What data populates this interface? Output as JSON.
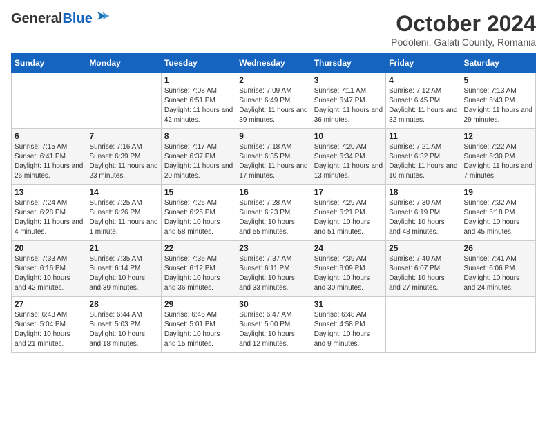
{
  "header": {
    "logo_line1": "General",
    "logo_line2": "Blue",
    "month_title": "October 2024",
    "location": "Podoleni, Galati County, Romania"
  },
  "weekdays": [
    "Sunday",
    "Monday",
    "Tuesday",
    "Wednesday",
    "Thursday",
    "Friday",
    "Saturday"
  ],
  "weeks": [
    [
      {
        "day": "",
        "sunrise": "",
        "sunset": "",
        "daylight": ""
      },
      {
        "day": "",
        "sunrise": "",
        "sunset": "",
        "daylight": ""
      },
      {
        "day": "1",
        "sunrise": "Sunrise: 7:08 AM",
        "sunset": "Sunset: 6:51 PM",
        "daylight": "Daylight: 11 hours and 42 minutes."
      },
      {
        "day": "2",
        "sunrise": "Sunrise: 7:09 AM",
        "sunset": "Sunset: 6:49 PM",
        "daylight": "Daylight: 11 hours and 39 minutes."
      },
      {
        "day": "3",
        "sunrise": "Sunrise: 7:11 AM",
        "sunset": "Sunset: 6:47 PM",
        "daylight": "Daylight: 11 hours and 36 minutes."
      },
      {
        "day": "4",
        "sunrise": "Sunrise: 7:12 AM",
        "sunset": "Sunset: 6:45 PM",
        "daylight": "Daylight: 11 hours and 32 minutes."
      },
      {
        "day": "5",
        "sunrise": "Sunrise: 7:13 AM",
        "sunset": "Sunset: 6:43 PM",
        "daylight": "Daylight: 11 hours and 29 minutes."
      }
    ],
    [
      {
        "day": "6",
        "sunrise": "Sunrise: 7:15 AM",
        "sunset": "Sunset: 6:41 PM",
        "daylight": "Daylight: 11 hours and 26 minutes."
      },
      {
        "day": "7",
        "sunrise": "Sunrise: 7:16 AM",
        "sunset": "Sunset: 6:39 PM",
        "daylight": "Daylight: 11 hours and 23 minutes."
      },
      {
        "day": "8",
        "sunrise": "Sunrise: 7:17 AM",
        "sunset": "Sunset: 6:37 PM",
        "daylight": "Daylight: 11 hours and 20 minutes."
      },
      {
        "day": "9",
        "sunrise": "Sunrise: 7:18 AM",
        "sunset": "Sunset: 6:35 PM",
        "daylight": "Daylight: 11 hours and 17 minutes."
      },
      {
        "day": "10",
        "sunrise": "Sunrise: 7:20 AM",
        "sunset": "Sunset: 6:34 PM",
        "daylight": "Daylight: 11 hours and 13 minutes."
      },
      {
        "day": "11",
        "sunrise": "Sunrise: 7:21 AM",
        "sunset": "Sunset: 6:32 PM",
        "daylight": "Daylight: 11 hours and 10 minutes."
      },
      {
        "day": "12",
        "sunrise": "Sunrise: 7:22 AM",
        "sunset": "Sunset: 6:30 PM",
        "daylight": "Daylight: 11 hours and 7 minutes."
      }
    ],
    [
      {
        "day": "13",
        "sunrise": "Sunrise: 7:24 AM",
        "sunset": "Sunset: 6:28 PM",
        "daylight": "Daylight: 11 hours and 4 minutes."
      },
      {
        "day": "14",
        "sunrise": "Sunrise: 7:25 AM",
        "sunset": "Sunset: 6:26 PM",
        "daylight": "Daylight: 11 hours and 1 minute."
      },
      {
        "day": "15",
        "sunrise": "Sunrise: 7:26 AM",
        "sunset": "Sunset: 6:25 PM",
        "daylight": "Daylight: 10 hours and 58 minutes."
      },
      {
        "day": "16",
        "sunrise": "Sunrise: 7:28 AM",
        "sunset": "Sunset: 6:23 PM",
        "daylight": "Daylight: 10 hours and 55 minutes."
      },
      {
        "day": "17",
        "sunrise": "Sunrise: 7:29 AM",
        "sunset": "Sunset: 6:21 PM",
        "daylight": "Daylight: 10 hours and 51 minutes."
      },
      {
        "day": "18",
        "sunrise": "Sunrise: 7:30 AM",
        "sunset": "Sunset: 6:19 PM",
        "daylight": "Daylight: 10 hours and 48 minutes."
      },
      {
        "day": "19",
        "sunrise": "Sunrise: 7:32 AM",
        "sunset": "Sunset: 6:18 PM",
        "daylight": "Daylight: 10 hours and 45 minutes."
      }
    ],
    [
      {
        "day": "20",
        "sunrise": "Sunrise: 7:33 AM",
        "sunset": "Sunset: 6:16 PM",
        "daylight": "Daylight: 10 hours and 42 minutes."
      },
      {
        "day": "21",
        "sunrise": "Sunrise: 7:35 AM",
        "sunset": "Sunset: 6:14 PM",
        "daylight": "Daylight: 10 hours and 39 minutes."
      },
      {
        "day": "22",
        "sunrise": "Sunrise: 7:36 AM",
        "sunset": "Sunset: 6:12 PM",
        "daylight": "Daylight: 10 hours and 36 minutes."
      },
      {
        "day": "23",
        "sunrise": "Sunrise: 7:37 AM",
        "sunset": "Sunset: 6:11 PM",
        "daylight": "Daylight: 10 hours and 33 minutes."
      },
      {
        "day": "24",
        "sunrise": "Sunrise: 7:39 AM",
        "sunset": "Sunset: 6:09 PM",
        "daylight": "Daylight: 10 hours and 30 minutes."
      },
      {
        "day": "25",
        "sunrise": "Sunrise: 7:40 AM",
        "sunset": "Sunset: 6:07 PM",
        "daylight": "Daylight: 10 hours and 27 minutes."
      },
      {
        "day": "26",
        "sunrise": "Sunrise: 7:41 AM",
        "sunset": "Sunset: 6:06 PM",
        "daylight": "Daylight: 10 hours and 24 minutes."
      }
    ],
    [
      {
        "day": "27",
        "sunrise": "Sunrise: 6:43 AM",
        "sunset": "Sunset: 5:04 PM",
        "daylight": "Daylight: 10 hours and 21 minutes."
      },
      {
        "day": "28",
        "sunrise": "Sunrise: 6:44 AM",
        "sunset": "Sunset: 5:03 PM",
        "daylight": "Daylight: 10 hours and 18 minutes."
      },
      {
        "day": "29",
        "sunrise": "Sunrise: 6:46 AM",
        "sunset": "Sunset: 5:01 PM",
        "daylight": "Daylight: 10 hours and 15 minutes."
      },
      {
        "day": "30",
        "sunrise": "Sunrise: 6:47 AM",
        "sunset": "Sunset: 5:00 PM",
        "daylight": "Daylight: 10 hours and 12 minutes."
      },
      {
        "day": "31",
        "sunrise": "Sunrise: 6:48 AM",
        "sunset": "Sunset: 4:58 PM",
        "daylight": "Daylight: 10 hours and 9 minutes."
      },
      {
        "day": "",
        "sunrise": "",
        "sunset": "",
        "daylight": ""
      },
      {
        "day": "",
        "sunrise": "",
        "sunset": "",
        "daylight": ""
      }
    ]
  ]
}
